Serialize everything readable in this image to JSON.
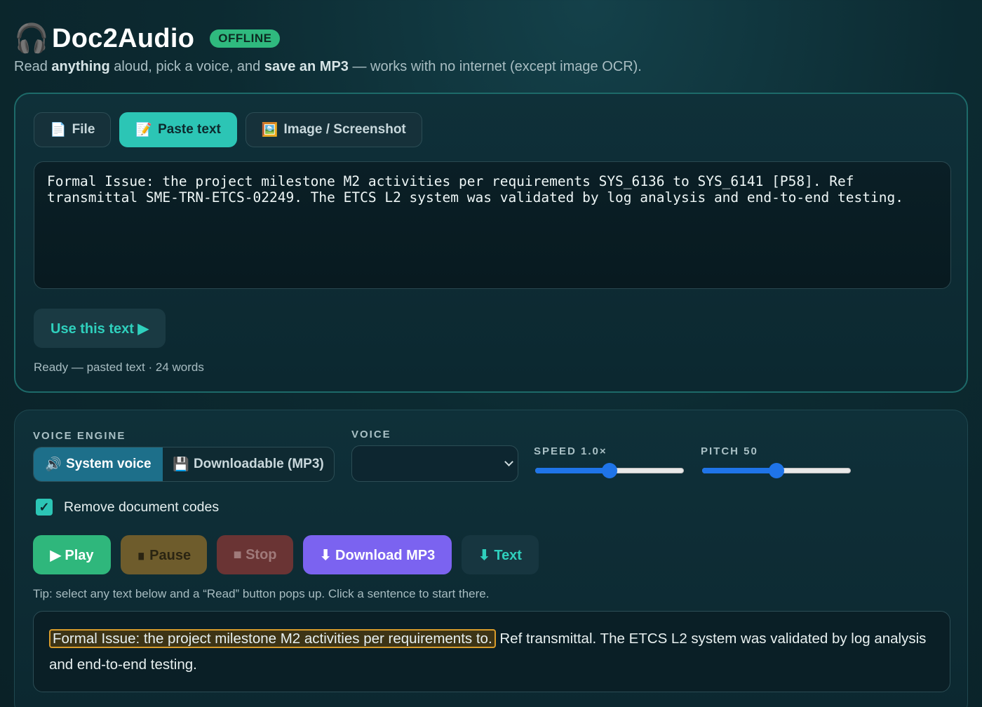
{
  "header": {
    "icon": "headphones-icon",
    "title": "Doc2Audio",
    "badge": "OFFLINE",
    "subtitle_pre": "Read ",
    "subtitle_b1": "anything",
    "subtitle_mid": " aloud, pick a voice, and ",
    "subtitle_b2": "save an MP3",
    "subtitle_post": " — works with no internet (except image OCR)."
  },
  "input_card": {
    "tabs": [
      {
        "icon": "📄",
        "label": "File",
        "active": false
      },
      {
        "icon": "📝",
        "label": "Paste text",
        "active": true
      },
      {
        "icon": "🖼️",
        "label": "Image / Screenshot",
        "active": false
      }
    ],
    "textarea_value": "Formal Issue: the project milestone M2 activities per requirements SYS_6136 to SYS_6141 [P58]. Ref transmittal SME-TRN-ETCS-02249. The ETCS L2 system was validated by log analysis and end-to-end testing.",
    "use_button": "Use this text ▶",
    "status": "Ready — pasted text · 24 words"
  },
  "voice_card": {
    "engine_label": "VOICE ENGINE",
    "engine_options": [
      {
        "icon": "🔊",
        "label": "System voice",
        "active": true
      },
      {
        "icon": "💾",
        "label": "Downloadable (MP3)",
        "active": false
      }
    ],
    "voice_label": "VOICE",
    "voice_value": "",
    "speed_label": "SPEED 1.0×",
    "speed_fraction": 0.5,
    "pitch_label": "PITCH 50",
    "pitch_fraction": 0.5,
    "checkbox_label": "Remove document codes",
    "checkbox_checked": true,
    "buttons": {
      "play": "▶ Play",
      "pause": "∎ Pause",
      "stop": "■ Stop",
      "download": "⬇ Download MP3",
      "text": "⬇ Text"
    },
    "tip": "Tip: select any text below and a “Read” button pops up. Click a sentence to start there.",
    "sentences": [
      "Formal Issue: the project milestone M2 activities per requirements to.",
      "Ref transmittal.",
      "The ETCS L2 system was validated by log analysis and end-to-end testing."
    ],
    "current_sentence": 0
  }
}
